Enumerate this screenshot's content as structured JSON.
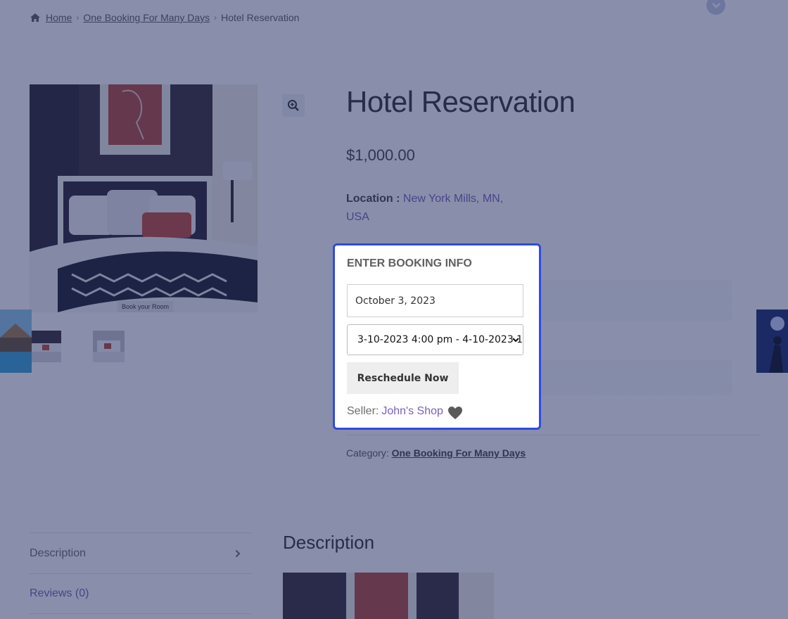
{
  "breadcrumb": {
    "home": "Home",
    "category": "One Booking For Many Days",
    "current": "Hotel Reservation",
    "separator": "›"
  },
  "product": {
    "title": "Hotel Reservation",
    "price": "$1,000.00",
    "location_label": "Location :",
    "location_value": "New York Mills, MN, USA",
    "image_caption": "Book your Room"
  },
  "booking": {
    "heading": "ENTER BOOKING INFO",
    "date_value": "October 3, 2023",
    "slot_selected": "3-10-2023 4:00 pm - 4-10-2023 1",
    "reschedule_label": "Reschedule Now",
    "seller_label": "Seller:",
    "seller_name": "John's Shop"
  },
  "meta": {
    "category_label": "Category:",
    "category_value": "One Booking For Many Days"
  },
  "tabs": [
    {
      "label": "Description"
    },
    {
      "label": "Reviews (0)"
    }
  ],
  "description": {
    "heading": "Description"
  },
  "colors": {
    "accent": "#7a5fbf",
    "highlight_border": "#2f4ae0",
    "overlay": "#1c285c"
  },
  "icons": [
    "home-icon",
    "zoom-icon",
    "chevron-down-icon",
    "heart-icon",
    "chevron-right-icon"
  ]
}
